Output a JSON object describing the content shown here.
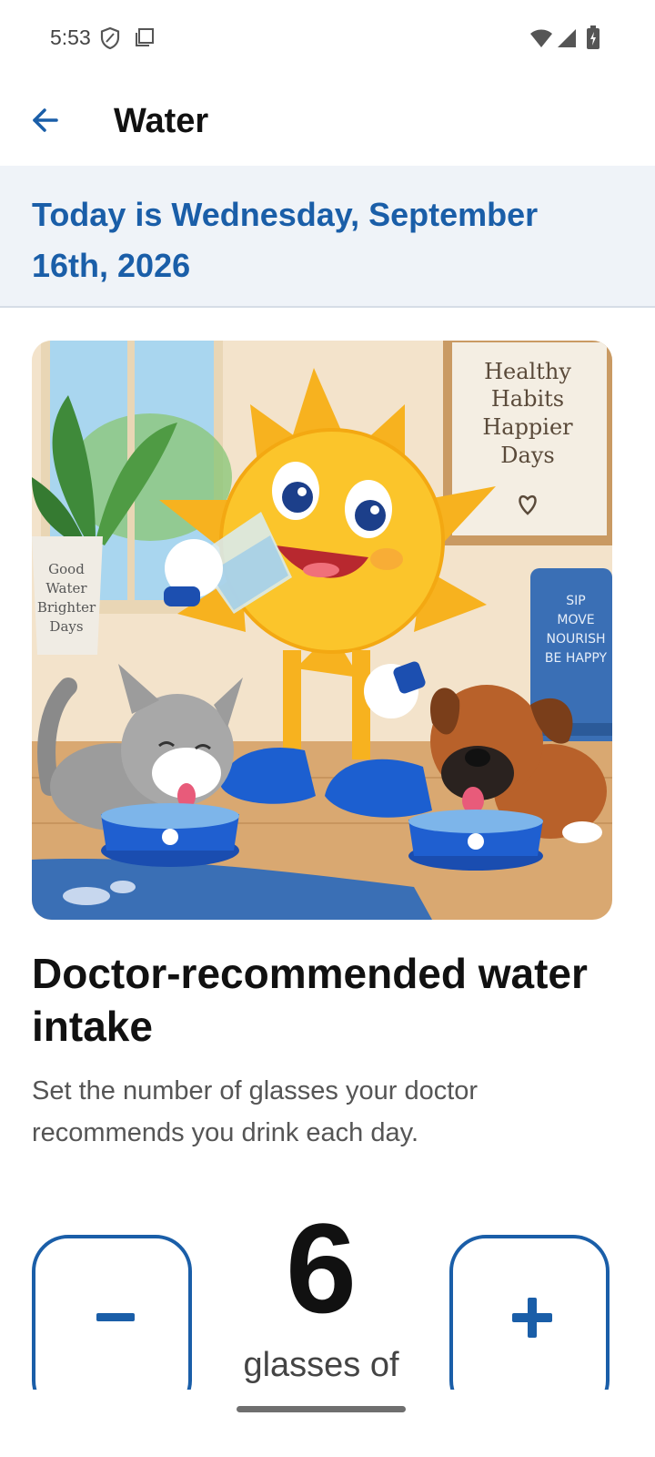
{
  "status_bar": {
    "time": "5:53",
    "icons": [
      "shield-icon",
      "screen-icon",
      "wifi-icon",
      "signal-icon",
      "battery-icon"
    ]
  },
  "app_bar": {
    "back_icon": "arrow-left-icon",
    "title": "Water"
  },
  "date_banner": {
    "text": "Today is Wednesday, September 16th, 2026"
  },
  "hero": {
    "sign_board_text": [
      "Healthy",
      "Habits",
      "Happier",
      "Days"
    ],
    "pot_text": [
      "Good",
      "Water",
      "Brighter",
      "Days"
    ],
    "towel_text": [
      "SIP",
      "MOVE",
      "NOURISH",
      "BE HAPPY"
    ]
  },
  "content": {
    "heading": "Doctor-recommended water intake",
    "description": "Set the number of glasses your doctor recommends you drink each day."
  },
  "stepper": {
    "value": "6",
    "unit_label": "glasses of",
    "decrement_icon": "minus-icon",
    "increment_icon": "plus-icon"
  },
  "colors": {
    "accent": "#1a5ea8",
    "banner_bg": "#eff3f8",
    "text_primary": "#111111",
    "text_secondary": "#555555"
  }
}
